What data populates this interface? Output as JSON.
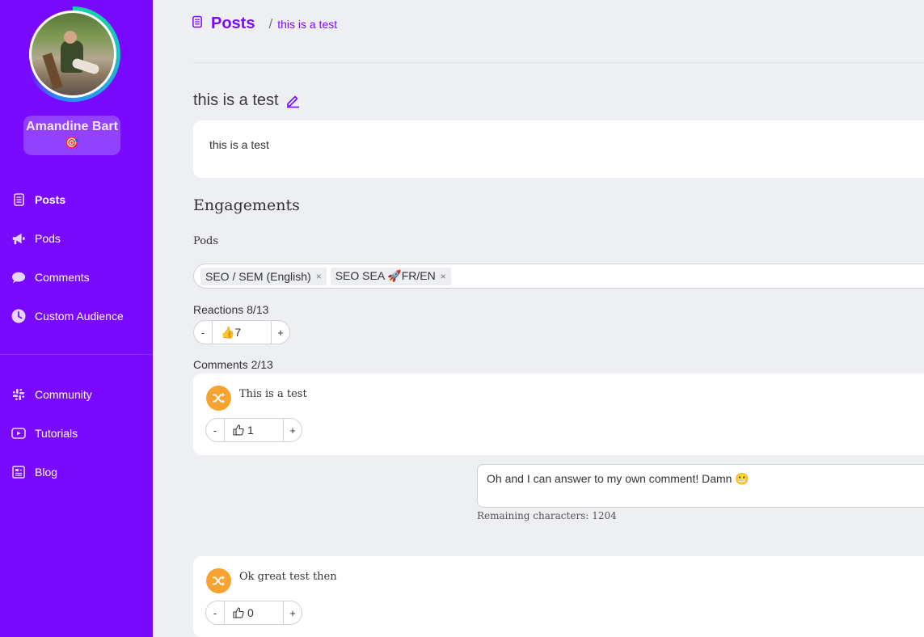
{
  "user": {
    "name": "Amandine Bart",
    "badge": "🎯"
  },
  "sidebar": {
    "items": [
      {
        "label": "Posts",
        "icon": "document-icon"
      },
      {
        "label": "Pods",
        "icon": "megaphone-icon"
      },
      {
        "label": "Comments",
        "icon": "speech-bubble-icon"
      },
      {
        "label": "Custom Audience",
        "icon": "clock-icon"
      },
      {
        "label": "Community",
        "icon": "slack-icon"
      },
      {
        "label": "Tutorials",
        "icon": "youtube-icon"
      },
      {
        "label": "Blog",
        "icon": "newspaper-icon"
      }
    ]
  },
  "breadcrumb": {
    "title": "Posts",
    "separator": "/",
    "current": "this is a test"
  },
  "post": {
    "title": "this is a test",
    "body": "this is a test"
  },
  "engagements": {
    "title": "Engagements",
    "pods_label": "Pods",
    "pods": [
      {
        "label": "SEO / SEM (English)",
        "remove": "×"
      },
      {
        "label": "SEO SEA 🚀FR/EN",
        "remove": "×"
      }
    ],
    "reactions_label": "Reactions 8/13",
    "reactions": {
      "minus": "-",
      "value": "👍7",
      "plus": "+"
    },
    "comments_label": "Comments 2/13"
  },
  "comments": [
    {
      "text": "This is a test",
      "minus": "-",
      "likes": "1",
      "plus": "+"
    },
    {
      "text": "Ok great test then",
      "minus": "-",
      "likes": "0",
      "plus": "+"
    }
  ],
  "reply": {
    "text": "Oh and I can answer to my own comment! Damn 😬",
    "remaining": "Remaining characters: 1204"
  },
  "colors": {
    "brand": "#7a0aff",
    "sidebar_bg": "#7a0aff",
    "comment_avatar": "#f7a331",
    "page_bg": "#eeeff3"
  }
}
